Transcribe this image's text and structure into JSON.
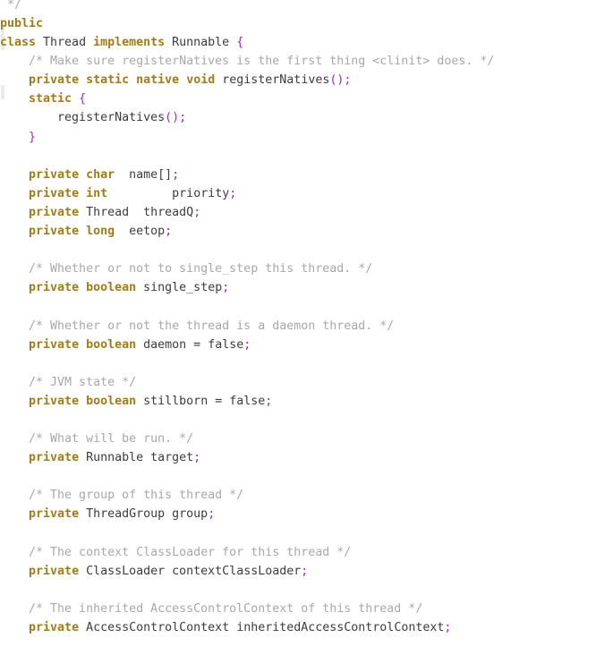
{
  "editor": {
    "language": "java",
    "file_kind": "source-code",
    "background_color": "#ffffff",
    "colors": {
      "keyword": "#a07c18",
      "identifier": "#3c3c3c",
      "comment": "#a8a8a8",
      "punctuation": "#9b30a8",
      "gutter_marker": "#d8d8d8"
    },
    "lines": [
      " */",
      "public",
      "class Thread implements Runnable {",
      "    /* Make sure registerNatives is the first thing <clinit> does. */",
      "    private static native void registerNatives();",
      "    static {",
      "        registerNatives();",
      "    }",
      "",
      "    private char  name[];",
      "    private int         priority;",
      "    private Thread  threadQ;",
      "    private long  eetop;",
      "",
      "    /* Whether or not to single_step this thread. */",
      "    private boolean single_step;",
      "",
      "    /* Whether or not the thread is a daemon thread. */",
      "    private boolean daemon = false;",
      "",
      "    /* JVM state */",
      "    private boolean stillborn = false;",
      "",
      "    /* What will be run. */",
      "    private Runnable target;",
      "",
      "    /* The group of this thread */",
      "    private ThreadGroup group;",
      "",
      "    /* The context ClassLoader for this thread */",
      "    private ClassLoader contextClassLoader;",
      "",
      "    /* The inherited AccessControlContext of this thread */",
      "    private AccessControlContext inheritedAccessControlContext;"
    ],
    "tokens": {
      "l0_comment_end": " */",
      "l1_public": "public",
      "l2_class": "class",
      "l2_thread": " Thread ",
      "l2_implements": "implements",
      "l2_runnable": " Runnable ",
      "l2_brace": "{",
      "l3_comment": "    /* Make sure registerNatives is the first thing <clinit> does. */",
      "l4_indent": "    ",
      "l4_private": "private",
      "l4_static": "static",
      "l4_native": "native",
      "l4_void": "void",
      "l4_name": " registerNatives",
      "l4_paren": "();",
      "l5_static": "static",
      "l5_brace": "{",
      "l6_call": "        registerNatives",
      "l6_paren": "();",
      "l7_brace": "    }",
      "l9_private": "private",
      "l9_char": "char",
      "l9_name": "  name[]",
      "l9_semi": ";",
      "l10_private": "private",
      "l10_int": "int",
      "l10_name": "         priority",
      "l10_semi": ";",
      "l11_private": "private",
      "l11_type": " Thread",
      "l11_name": "  threadQ",
      "l11_semi": ";",
      "l12_private": "private",
      "l12_long": "long",
      "l12_name": "  eetop",
      "l12_semi": ";",
      "l14_comment": "    /* Whether or not to single_step this thread. */",
      "l15_private": "private",
      "l15_boolean": "boolean",
      "l15_name": " single_step",
      "l15_semi": ";",
      "l17_comment": "    /* Whether or not the thread is a daemon thread. */",
      "l18_private": "private",
      "l18_boolean": "boolean",
      "l18_name": " daemon = false",
      "l18_semi": ";",
      "l20_comment": "    /* JVM state */",
      "l21_private": "private",
      "l21_boolean": "boolean",
      "l21_name": " stillborn = false",
      "l21_semi": ";",
      "l23_comment": "    /* What will be run. */",
      "l24_private": "private",
      "l24_type": " Runnable target",
      "l24_semi": ";",
      "l26_comment": "    /* The group of this thread */",
      "l27_private": "private",
      "l27_type": " ThreadGroup group",
      "l27_semi": ";",
      "l29_comment": "    /* The context ClassLoader for this thread */",
      "l30_private": "private",
      "l30_type": " ClassLoader contextClassLoader",
      "l30_semi": ";",
      "l32_comment": "    /* The inherited AccessControlContext of this thread */",
      "l33_private": "private",
      "l33_type": " AccessControlContext inheritedAccessControlContext",
      "l33_semi": ";"
    }
  }
}
